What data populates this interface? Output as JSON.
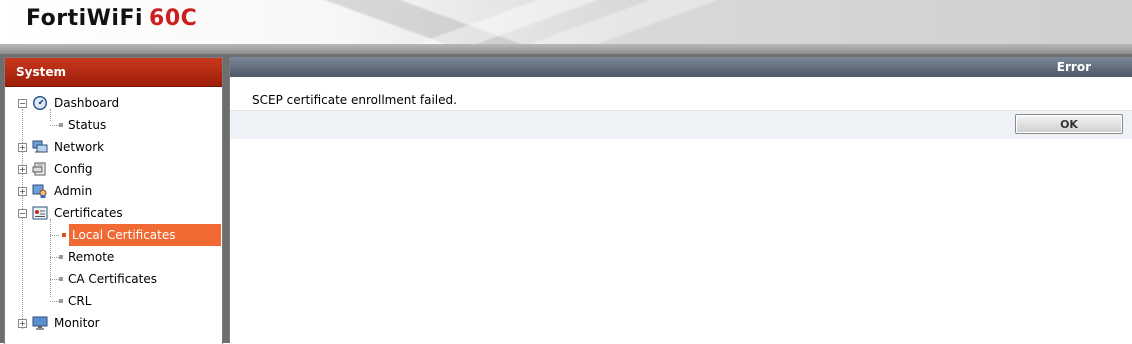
{
  "header": {
    "brand": "FortiWiFi",
    "model": "60C"
  },
  "sidebar": {
    "title": "System",
    "items": [
      {
        "label": "Dashboard",
        "icon": "dashboard-icon",
        "expander": "−"
      },
      {
        "label": "Status"
      },
      {
        "label": "Network",
        "icon": "network-icon",
        "expander": "+"
      },
      {
        "label": "Config",
        "icon": "config-icon",
        "expander": "+"
      },
      {
        "label": "Admin",
        "icon": "admin-icon",
        "expander": "+"
      },
      {
        "label": "Certificates",
        "icon": "certificate-icon",
        "expander": "−"
      },
      {
        "label": "Local Certificates",
        "selected": true
      },
      {
        "label": "Remote"
      },
      {
        "label": "CA Certificates"
      },
      {
        "label": "CRL"
      },
      {
        "label": "Monitor",
        "icon": "monitor-icon",
        "expander": "+"
      }
    ]
  },
  "main": {
    "title": "Error",
    "message": "SCEP certificate enrollment failed.",
    "ok_label": "OK"
  },
  "colors": {
    "sidebar_title": "#b02a12",
    "selected_item": "#f26a33",
    "main_title": "#5a6575",
    "brand_model": "#cc1f1f"
  }
}
